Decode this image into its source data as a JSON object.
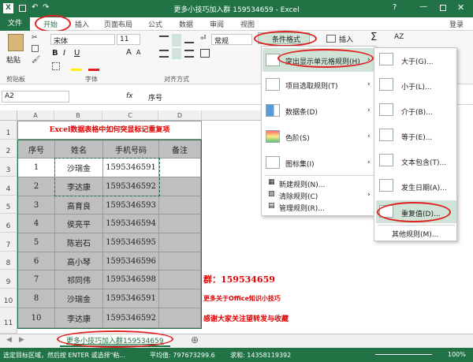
{
  "window": {
    "title": "更多小技巧加入群 159534659 - Excel",
    "user": "登录"
  },
  "tabs": [
    "文件",
    "开始",
    "插入",
    "页面布局",
    "公式",
    "数据",
    "审阅",
    "视图"
  ],
  "ribbon": {
    "font_name": "宋体",
    "font_size": "11",
    "bold": "B",
    "italic": "I",
    "underline": "U",
    "font_grow": "A",
    "font_shrink": "A",
    "number_format": "常规",
    "paste": "粘贴",
    "cond_format": "条件格式",
    "insert": "插入",
    "sum": "Σ",
    "groups": [
      "剪贴板",
      "字体",
      "对齐方式"
    ]
  },
  "formula_bar": {
    "name_box": "A2",
    "fx": "fx",
    "value": "序号"
  },
  "columns": [
    "A",
    "B",
    "C",
    "D"
  ],
  "rows": [
    "1",
    "2",
    "3",
    "4",
    "5",
    "6",
    "7",
    "8",
    "9",
    "10",
    "11"
  ],
  "sheet_title": "Excel数据表格中如何突显标记重复项",
  "table": {
    "headers": [
      "序号",
      "姓名",
      "手机号码",
      "备注"
    ],
    "rows": [
      [
        "1",
        "沙瑞金",
        "1595346591",
        ""
      ],
      [
        "2",
        "李达康",
        "1595346592",
        ""
      ],
      [
        "3",
        "高育良",
        "1595346593",
        ""
      ],
      [
        "4",
        "侯亮平",
        "1595346594",
        ""
      ],
      [
        "5",
        "陈岩石",
        "1595346595",
        ""
      ],
      [
        "6",
        "高小琴",
        "1595346596",
        ""
      ],
      [
        "7",
        "祁同伟",
        "1595346598",
        ""
      ],
      [
        "8",
        "沙瑞金",
        "1595346591",
        ""
      ],
      [
        "10",
        "李达康",
        "1595346592",
        ""
      ]
    ]
  },
  "notes": [
    "群：159534659",
    "更多关于Office知识小技巧",
    "感谢大家关注望转发与收藏"
  ],
  "menu": {
    "items": [
      "突出显示单元格规则(H)",
      "项目选取规则(T)",
      "数据条(D)",
      "色阶(S)",
      "图标集(I)"
    ],
    "links": [
      "新建规则(N)...",
      "清除规则(C)",
      "管理规则(R)..."
    ]
  },
  "submenu": {
    "items": [
      "大于(G)...",
      "小于(L)...",
      "介于(B)...",
      "等于(E)...",
      "文本包含(T)...",
      "发生日期(A)...",
      "重复值(D)..."
    ],
    "more": "其他规则(M)..."
  },
  "sheet_tab": "更多小技巧加入群159534659",
  "add_sheet": "⊕",
  "status": {
    "hint": "选定目标区域，然后按 ENTER 或选择\"粘...",
    "avg": "平均值: 797673299.6",
    "sum": "求和: 14358119392",
    "zoom": "100%"
  },
  "colors": {
    "accent": "#217346",
    "highlight": "#e02020",
    "title_red": "#e00000"
  }
}
